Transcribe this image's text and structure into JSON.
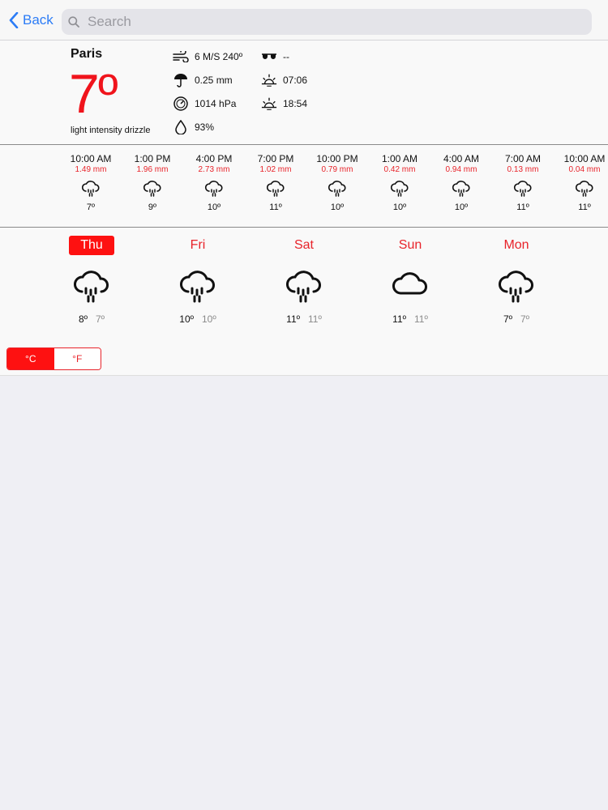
{
  "nav": {
    "back_label": "Back",
    "search_placeholder": "Search"
  },
  "current": {
    "city": "Paris",
    "temperature": "7º",
    "description": "light intensity drizzle",
    "wind": "6 M/S 240º",
    "precipitation": "0.25 mm",
    "pressure": "1014 hPa",
    "humidity": "93%",
    "visibility": "--",
    "sunrise": "07:06",
    "sunset": "18:54"
  },
  "hourly": [
    {
      "time": "10:00 AM",
      "precip": "1.49 mm",
      "icon": "rain-icon",
      "temp": "7º"
    },
    {
      "time": "1:00 PM",
      "precip": "1.96 mm",
      "icon": "rain-icon",
      "temp": "9º"
    },
    {
      "time": "4:00 PM",
      "precip": "2.73 mm",
      "icon": "rain-icon",
      "temp": "10º"
    },
    {
      "time": "7:00 PM",
      "precip": "1.02 mm",
      "icon": "rain-icon",
      "temp": "11º"
    },
    {
      "time": "10:00 PM",
      "precip": "0.79 mm",
      "icon": "rain-icon",
      "temp": "10º"
    },
    {
      "time": "1:00 AM",
      "precip": "0.42 mm",
      "icon": "rain-icon",
      "temp": "10º"
    },
    {
      "time": "4:00 AM",
      "precip": "0.94 mm",
      "icon": "rain-icon",
      "temp": "10º"
    },
    {
      "time": "7:00 AM",
      "precip": "0.13 mm",
      "icon": "rain-icon",
      "temp": "11º"
    },
    {
      "time": "10:00 AM",
      "precip": "0.04 mm",
      "icon": "rain-icon",
      "temp": "11º"
    }
  ],
  "daily": [
    {
      "day": "Thu",
      "selected": true,
      "icon": "rain-icon",
      "high": "8º",
      "low": "7º"
    },
    {
      "day": "Fri",
      "selected": false,
      "icon": "rain-icon",
      "high": "10º",
      "low": "10º"
    },
    {
      "day": "Sat",
      "selected": false,
      "icon": "rain-icon",
      "high": "11º",
      "low": "11º"
    },
    {
      "day": "Sun",
      "selected": false,
      "icon": "cloud-icon",
      "high": "11º",
      "low": "11º"
    },
    {
      "day": "Mon",
      "selected": false,
      "icon": "rain-icon",
      "high": "7º",
      "low": "7º"
    }
  ],
  "units": {
    "celsius": "°C",
    "fahrenheit": "°F",
    "selected": "celsius"
  },
  "colors": {
    "accent": "#fe1111",
    "link": "#2c7cf6",
    "precip_text": "#e8232a"
  }
}
